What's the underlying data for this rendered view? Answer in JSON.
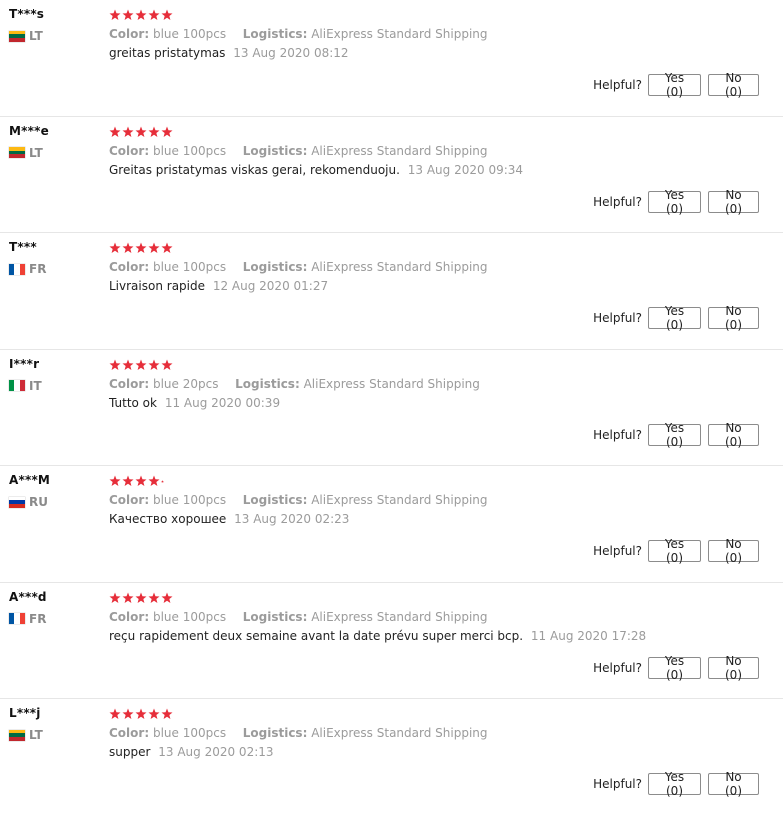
{
  "labels": {
    "color": "Color:",
    "logistics": "Logistics:",
    "helpful": "Helpful?"
  },
  "colors": {
    "star": "#e62e3a",
    "muted_text": "#9b9b9b",
    "divider": "#e6e6e6"
  },
  "flags": {
    "LT": {
      "orientation": "h",
      "stripes": [
        "#fdb913",
        "#006a44",
        "#c1272d"
      ]
    },
    "FR": {
      "orientation": "v",
      "stripes": [
        "#0055a4",
        "#ffffff",
        "#ef4135"
      ]
    },
    "IT": {
      "orientation": "v",
      "stripes": [
        "#009246",
        "#ffffff",
        "#ce2b37"
      ]
    },
    "RU": {
      "orientation": "h",
      "stripes": [
        "#ffffff",
        "#0039a6",
        "#d52b1e"
      ]
    }
  },
  "reviews": [
    {
      "user": "T***s",
      "country": "LT",
      "rating": 5,
      "color": "blue 100pcs",
      "logistics": "AliExpress Standard Shipping",
      "text": "greitas pristatymas",
      "date": "13 Aug 2020 08:12",
      "yes": "Yes (0)",
      "no": "No (0)"
    },
    {
      "user": "M***e",
      "country": "LT",
      "rating": 5,
      "color": "blue 100pcs",
      "logistics": "AliExpress Standard Shipping",
      "text": "Greitas pristatymas viskas gerai, rekomenduoju.",
      "date": "13 Aug 2020 09:34",
      "yes": "Yes (0)",
      "no": "No (0)"
    },
    {
      "user": "T***",
      "country": "FR",
      "rating": 5,
      "color": "blue 100pcs",
      "logistics": "AliExpress Standard Shipping",
      "text": "Livraison rapide",
      "date": "12 Aug 2020 01:27",
      "yes": "Yes (0)",
      "no": "No (0)"
    },
    {
      "user": "I***r",
      "country": "IT",
      "rating": 5,
      "color": "blue 20pcs",
      "logistics": "AliExpress Standard Shipping",
      "text": "Tutto ok",
      "date": "11 Aug 2020 00:39",
      "yes": "Yes (0)",
      "no": "No (0)"
    },
    {
      "user": "A***M",
      "country": "RU",
      "rating": 5,
      "small_last_star": true,
      "color": "blue 100pcs",
      "logistics": "AliExpress Standard Shipping",
      "text": "Качество хорошее",
      "date": "13 Aug 2020 02:23",
      "yes": "Yes (0)",
      "no": "No (0)"
    },
    {
      "user": "A***d",
      "country": "FR",
      "rating": 5,
      "color": "blue 100pcs",
      "logistics": "AliExpress Standard Shipping",
      "text": "reçu rapidement deux semaine avant la date prévu super merci bcp.",
      "date": "11 Aug 2020 17:28",
      "yes": "Yes (0)",
      "no": "No (0)"
    },
    {
      "user": "L***j",
      "country": "LT",
      "rating": 5,
      "color": "blue 100pcs",
      "logistics": "AliExpress Standard Shipping",
      "text": "supper",
      "date": "13 Aug 2020 02:13",
      "yes": "Yes (0)",
      "no": "No (0)"
    }
  ]
}
